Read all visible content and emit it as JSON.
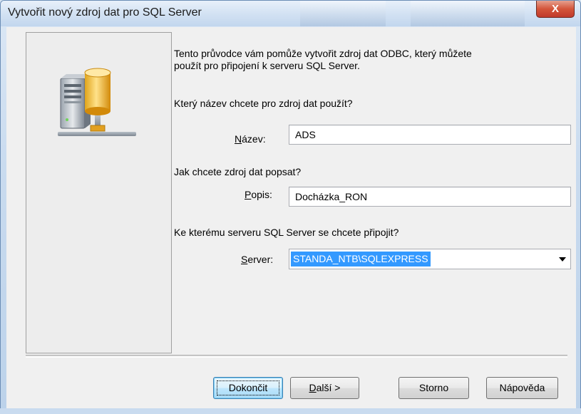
{
  "window": {
    "title": "Vytvořit nový zdroj dat pro SQL Server",
    "close_label": "X"
  },
  "wizard": {
    "intro": "Tento průvodce vám pomůže vytvořit zdroj dat ODBC, který můžete\npoužít pro připojení k serveru SQL Server.",
    "name_question": "Který název chcete pro zdroj dat použít?",
    "name_label_mn": "N",
    "name_label_rest": "ázev:",
    "name_value": "ADS",
    "desc_question": "Jak chcete zdroj dat popsat?",
    "desc_label_mn": "P",
    "desc_label_rest": "opis:",
    "desc_value": "Docházka_RON",
    "server_question": "Ke kterému serveru SQL Server se chcete připojit?",
    "server_label_mn": "S",
    "server_label_rest": "erver:",
    "server_value": "STANDA_NTB\\SQLEXPRESS"
  },
  "buttons": {
    "finish": "Dokončit",
    "next_mn": "D",
    "next_rest": "alší >",
    "cancel": "Storno",
    "help": "Nápověda"
  },
  "colors": {
    "selection": "#3399ff",
    "close_button": "#c0392b",
    "default_button_border": "#3c7fb1"
  },
  "icons": {
    "banner": "database-server-icon",
    "dropdown": "chevron-down-icon"
  }
}
